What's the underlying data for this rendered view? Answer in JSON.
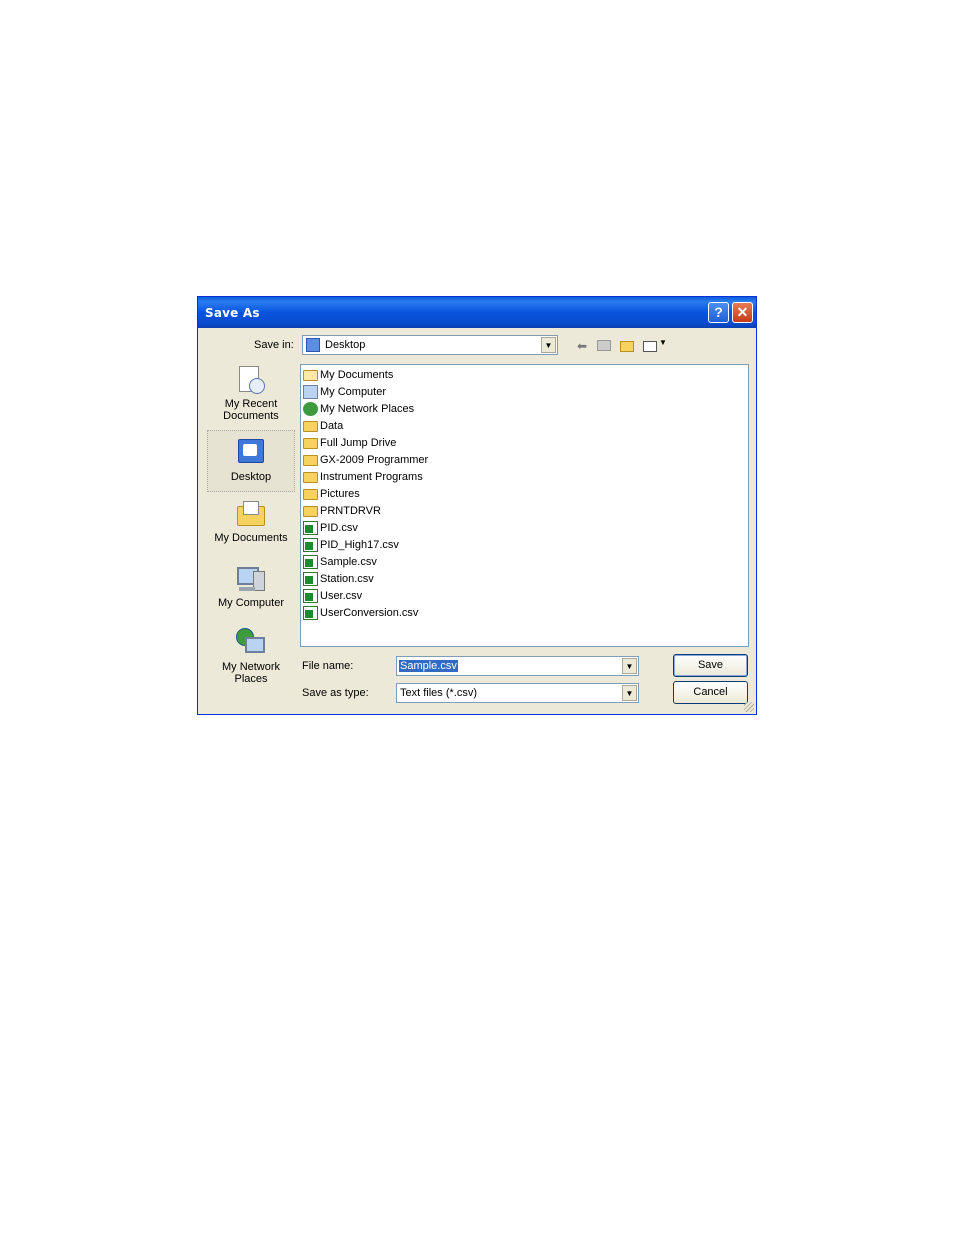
{
  "window": {
    "title": "Save As",
    "help_label": "?",
    "close_label": "✕"
  },
  "save_in": {
    "label": "Save in:",
    "value": "Desktop"
  },
  "toolbar": {
    "back_icon": "back-arrow-icon",
    "up_icon": "up-folder-icon",
    "new_folder_icon": "new-folder-icon",
    "views_icon": "views-menu-icon"
  },
  "places": [
    {
      "label_line1": "My Recent",
      "label_line2": "Documents",
      "icon": "recent-documents-icon"
    },
    {
      "label_line1": "Desktop",
      "label_line2": "",
      "icon": "desktop-icon",
      "selected": true
    },
    {
      "label_line1": "My Documents",
      "label_line2": "",
      "icon": "my-documents-icon"
    },
    {
      "label_line1": "My Computer",
      "label_line2": "",
      "icon": "my-computer-icon"
    },
    {
      "label_line1": "My Network",
      "label_line2": "Places",
      "icon": "network-places-icon"
    }
  ],
  "files": [
    {
      "name": "My Documents",
      "type": "special"
    },
    {
      "name": "My Computer",
      "type": "computer"
    },
    {
      "name": "My Network Places",
      "type": "network"
    },
    {
      "name": "Data",
      "type": "folder"
    },
    {
      "name": "Full Jump Drive",
      "type": "folder"
    },
    {
      "name": "GX-2009 Programmer",
      "type": "folder"
    },
    {
      "name": "Instrument Programs",
      "type": "folder"
    },
    {
      "name": "Pictures",
      "type": "folder"
    },
    {
      "name": "PRNTDRVR",
      "type": "folder"
    },
    {
      "name": "PID.csv",
      "type": "csv"
    },
    {
      "name": "PID_High17.csv",
      "type": "csv"
    },
    {
      "name": "Sample.csv",
      "type": "csv"
    },
    {
      "name": "Station.csv",
      "type": "csv"
    },
    {
      "name": "User.csv",
      "type": "csv"
    },
    {
      "name": "UserConversion.csv",
      "type": "csv"
    }
  ],
  "file_name": {
    "label": "File name:",
    "value": "Sample.csv"
  },
  "save_as_type": {
    "label": "Save as type:",
    "value": "Text files (*.csv)"
  },
  "buttons": {
    "save": "Save",
    "cancel": "Cancel"
  }
}
